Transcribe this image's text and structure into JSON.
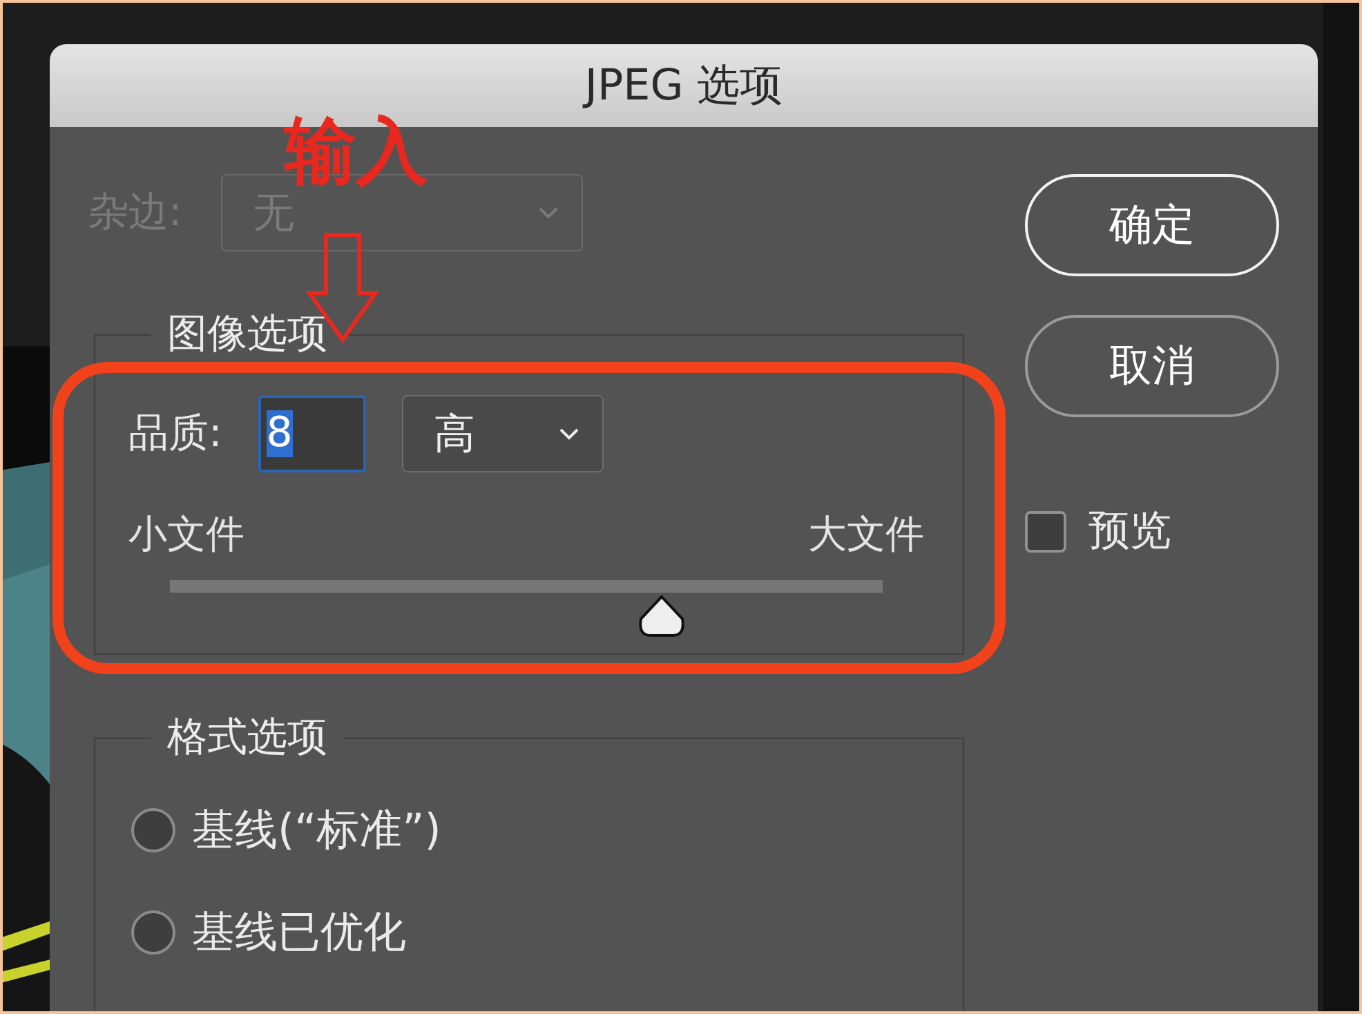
{
  "window": {
    "title": "JPEG 选项"
  },
  "matte": {
    "label": "杂边:",
    "value": "无",
    "disabled": true
  },
  "image_options": {
    "title": "图像选项",
    "quality_label": "品质:",
    "quality_value": "8",
    "quality_preset": "高",
    "small_label": "小文件",
    "large_label": "大文件",
    "level": 0.69
  },
  "format_options": {
    "title": "格式选项",
    "options": [
      {
        "label": "基线(“标准”)",
        "selected": false
      },
      {
        "label": "基线已优化",
        "selected": false
      }
    ]
  },
  "buttons": [
    "确定",
    "取消"
  ],
  "preview": {
    "label": "预览",
    "checked": false
  },
  "annotation": {
    "label": "输入"
  }
}
